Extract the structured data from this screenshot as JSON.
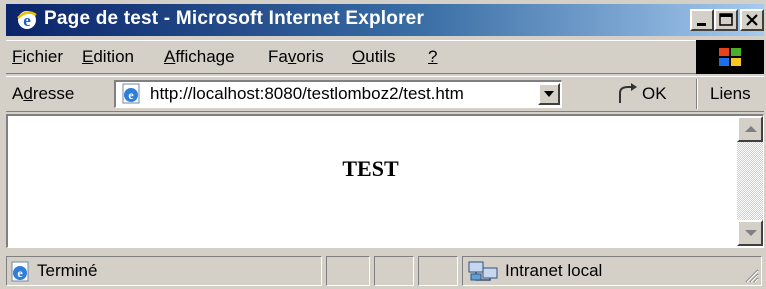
{
  "window": {
    "title": "Page de test - Microsoft Internet Explorer"
  },
  "menu": {
    "items": [
      {
        "first": "F",
        "rest": "ichier"
      },
      {
        "first": "E",
        "rest": "dition"
      },
      {
        "first": "A",
        "rest": "ffichage"
      },
      {
        "pre": "Fa",
        "first": "v",
        "rest": "oris"
      },
      {
        "first": "O",
        "rest": "utils"
      },
      {
        "first": "?",
        "rest": ""
      }
    ]
  },
  "address": {
    "label_pre": "A",
    "label_u": "d",
    "label_rest": "resse",
    "url": "http://localhost:8080/testlomboz2/test.htm",
    "go_label": "OK",
    "links_label": "Liens"
  },
  "page": {
    "heading": "TEST"
  },
  "status": {
    "text": "Terminé",
    "zone": "Intranet local"
  },
  "colors": {
    "titlebar_start": "#0a246a",
    "titlebar_end": "#a6caf0",
    "chrome": "#d4d0c8"
  },
  "icons": {
    "title": "ie-logo-icon",
    "address": "page-icon",
    "go": "go-arrow-icon",
    "status": "page-icon",
    "zone": "intranet-icon"
  }
}
